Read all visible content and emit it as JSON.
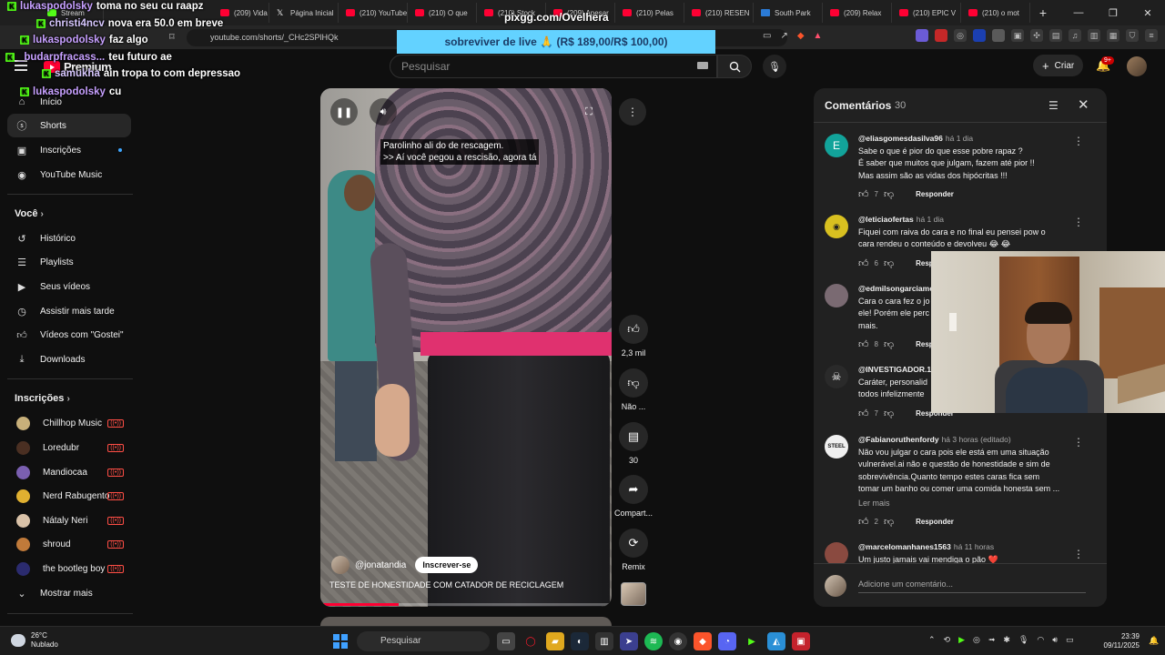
{
  "browser": {
    "tabs": [
      {
        "label": "Stream",
        "icon": "kick-icon"
      },
      {
        "label": "(209) Vida",
        "icon": "youtube-icon"
      },
      {
        "label": "Página Inicial",
        "icon": "x-icon"
      },
      {
        "label": "(210) YouTube",
        "icon": "youtube-icon"
      },
      {
        "label": "(210) O que",
        "icon": "youtube-icon"
      },
      {
        "label": "(210) Stock",
        "icon": "youtube-icon"
      },
      {
        "label": "(209) Apesar",
        "icon": "youtube-icon"
      },
      {
        "label": "(210) Pelas",
        "icon": "youtube-icon"
      },
      {
        "label": "(210) RESEN",
        "icon": "youtube-icon"
      },
      {
        "label": "South Park",
        "icon": "site-icon"
      },
      {
        "label": "(209) Relax",
        "icon": "youtube-icon"
      },
      {
        "label": "(210) EPIC V",
        "icon": "youtube-icon"
      },
      {
        "label": "(210) o mot",
        "icon": "youtube-icon"
      }
    ],
    "new_tab": "+",
    "url": "youtube.com/shorts/_CHc2SPlHQk"
  },
  "header": {
    "logo": "Premium",
    "search_placeholder": "Pesquisar",
    "create_label": "Criar",
    "notifications_badge": "9+"
  },
  "sidebar": {
    "top": [
      {
        "label": "Início",
        "icon": "home-icon"
      },
      {
        "label": "Shorts",
        "icon": "shorts-icon"
      },
      {
        "label": "Inscrições",
        "icon": "subscriptions-icon"
      },
      {
        "label": "YouTube Music",
        "icon": "music-icon"
      }
    ],
    "you_heading": "Você",
    "you": [
      {
        "label": "Histórico",
        "icon": "history-icon"
      },
      {
        "label": "Playlists",
        "icon": "playlists-icon"
      },
      {
        "label": "Seus vídeos",
        "icon": "your-videos-icon"
      },
      {
        "label": "Assistir mais tarde",
        "icon": "watch-later-icon"
      },
      {
        "label": "Vídeos com \"Gostei\"",
        "icon": "like-icon"
      },
      {
        "label": "Downloads",
        "icon": "download-icon"
      }
    ],
    "subs_heading": "Inscrições",
    "subs": [
      {
        "label": "Chillhop Music",
        "color": "#c8b07a"
      },
      {
        "label": "Loredubr",
        "color": "#4a2f22"
      },
      {
        "label": "Mandiocaa",
        "color": "#7a5fb0"
      },
      {
        "label": "Nerd Rabugento",
        "color": "#e0b030"
      },
      {
        "label": "Nátaly Neri",
        "color": "#d9c2a8"
      },
      {
        "label": "shroud",
        "color": "#c07a3a"
      },
      {
        "label": "the bootleg boy",
        "color": "#2b2b6e"
      }
    ],
    "show_more": "Mostrar mais"
  },
  "video": {
    "subtitle_line1": "Parolinho ali do de rescagem.",
    "subtitle_line2": ">> Aí você pegou a rescisão, agora tá",
    "channel": "@jonatandia",
    "subscribe_label": "Inscrever-se",
    "title": "TESTE DE HONESTIDADE COM CATADOR DE RECICLAGEM",
    "progress": 0.27
  },
  "actions": {
    "like_count": "2,3 mil",
    "dislike_label": "Não ...",
    "comment_count": "30",
    "share_label": "Compart...",
    "remix_label": "Remix"
  },
  "comments": {
    "title": "Comentários",
    "count": "30",
    "items": [
      {
        "author": "@eliasgomesdasilva96",
        "time": "há 1 dia",
        "avatar_letter": "E",
        "avatar_color": "#12a39a",
        "lines": [
          "Sabe o que é pior do que esse pobre rapaz ?",
          "É saber que muitos que julgam, fazem até pior !!",
          "Mas assim são as vidas dos hipócritas !!!"
        ],
        "likes": "7",
        "reply": "Responder"
      },
      {
        "author": "@leticiaofertas",
        "time": "há 1 dia",
        "avatar_letter": "",
        "avatar_color": "#d8c020",
        "lines": [
          "Fiquei com raiva do cara e no final eu pensei pow o",
          "cara rendeu o conteúdo e devolveu 😂 😂"
        ],
        "likes": "6",
        "reply": "Responder"
      },
      {
        "author": "@edmilsongarciame",
        "time": "",
        "avatar_letter": "",
        "avatar_color": "#7a6a72",
        "lines": [
          "Cara o cara fez o jo",
          "ele! Porém ele perc",
          "mais."
        ],
        "likes": "8",
        "reply": "Responder"
      },
      {
        "author": "@INVESTIGADOR.19",
        "time": "",
        "avatar_letter": "",
        "avatar_color": "#2a2a2a",
        "lines": [
          "Caráter, personalid",
          "todos infelizmente"
        ],
        "likes": "7",
        "reply": "Responder"
      },
      {
        "author": "@Fabianoruthenfordy",
        "time": "há 3 horas (editado)",
        "avatar_letter": "STEEL",
        "avatar_color": "#f0f0f0",
        "lines": [
          "Não vou julgar o cara pois ele está em uma situação",
          "vulnerável.ai não e questão de honestidade e sim de",
          "sobrevivência.Quanto tempo estes caras fica sem",
          "tomar um banho ou comer uma comida honesta sem ..."
        ],
        "read_more": "Ler mais",
        "likes": "2",
        "reply": "Responder"
      },
      {
        "author": "@marcelomanhanes1563",
        "time": "há 11 horas",
        "avatar_letter": "",
        "avatar_color": "#8a4a40",
        "lines": [
          "Um justo jamais vai mendiga o pão ❤️"
        ],
        "likes": "",
        "reply": "Responder"
      }
    ],
    "add_placeholder": "Adicione um comentário..."
  },
  "overlay": {
    "pix_title": "pixgg.com/Ovelhera",
    "pix_goal": "sobreviver de live 🙏 (R$ 189,00/R$ 100,00)",
    "chat": [
      {
        "user": "lukaspodolsky",
        "msg": "toma no seu cu raapz"
      },
      {
        "user": "christi4ncv",
        "msg": "nova era 50.0 em breve"
      },
      {
        "user": "lukaspodolsky",
        "msg": "faz algo"
      },
      {
        "user": "_budarpfracass...",
        "msg": "teu futuro ae"
      },
      {
        "user": "samukha",
        "msg": "ain tropa to com depressao"
      },
      {
        "user": "lukaspodolsky",
        "msg": "cu"
      }
    ]
  },
  "taskbar": {
    "temp": "26°C",
    "weather": "Nublado",
    "search": "Pesquisar",
    "time": "23:39",
    "date": "09/11/2025"
  }
}
